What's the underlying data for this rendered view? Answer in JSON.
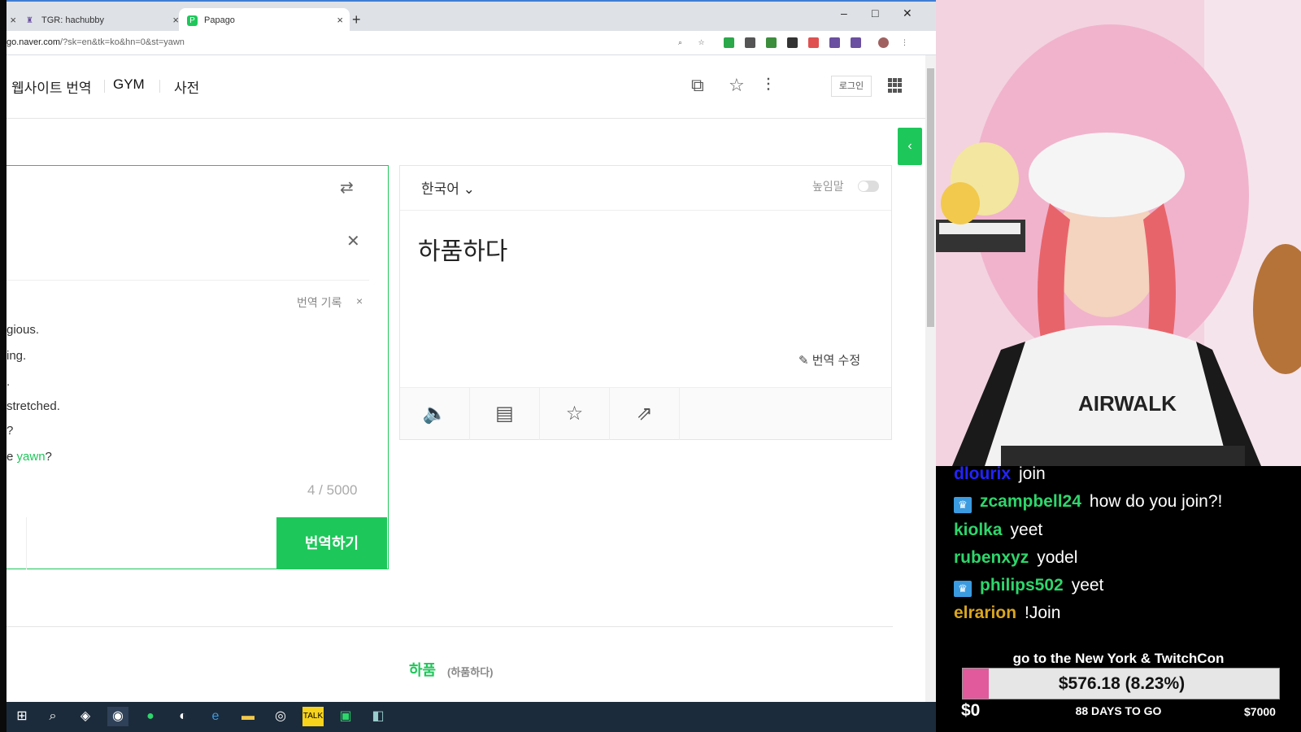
{
  "browser": {
    "tabs": [
      {
        "title": "",
        "close": "×"
      },
      {
        "title": "TGR: hachubby",
        "close": "×"
      },
      {
        "title": "Papago",
        "close": "×",
        "active": true
      }
    ],
    "new_tab": "+",
    "window_controls": {
      "minimize": "–",
      "maximize": "□",
      "close": "✕"
    },
    "url_prefix": "go.naver.com",
    "url_rest": "/?sk=en&tk=ko&hn=0&st=yawn"
  },
  "papago": {
    "nav": [
      "웹사이트 번역",
      "GYM",
      "사전"
    ],
    "login": "로그인",
    "source": {
      "history_label": "번역 기록",
      "history": [
        {
          "pre": "gious.",
          "hl": "",
          "post": ""
        },
        {
          "pre": "ing.",
          "hl": "",
          "post": ""
        },
        {
          "pre": ".",
          "hl": "",
          "post": ""
        },
        {
          "pre": "stretched.",
          "hl": "",
          "post": ""
        },
        {
          "pre": "?",
          "hl": "",
          "post": ""
        },
        {
          "pre": "e ",
          "hl": "yawn",
          "post": "?"
        }
      ],
      "counter": "4 / 5000",
      "translate_button": "번역하기"
    },
    "target": {
      "language": "한국어",
      "honorific": "높임말",
      "text": "하품하다",
      "edit": "번역 수정"
    },
    "dictionary": {
      "word": "하품",
      "sub": "(하품하다)"
    }
  },
  "chat": [
    {
      "user": "dlourix",
      "color": "#2323ff",
      "badge": false,
      "text": "join"
    },
    {
      "user": "zcampbell24",
      "color": "#2ed66b",
      "badge": true,
      "text": "how do you join?!"
    },
    {
      "user": "kiolka",
      "color": "#2ed66b",
      "badge": false,
      "text": "yeet"
    },
    {
      "user": "rubenxyz",
      "color": "#2ed66b",
      "badge": false,
      "text": "yodel"
    },
    {
      "user": "philips502",
      "color": "#2ed66b",
      "badge": true,
      "text": "yeet"
    },
    {
      "user": "elrarion",
      "color": "#daa520",
      "badge": false,
      "text": "!Join"
    }
  ],
  "goal": {
    "title": "go to the New York & TwitchCon",
    "amount": "$576.18 (8.23%)",
    "progress": 0.0823,
    "min": "$0",
    "max": "$7000",
    "days": "88 DAYS TO GO",
    "fill_color": "#e05a9c"
  },
  "colors": {
    "accent": "#1ec75a",
    "taskbar": "#1c2b3b"
  }
}
